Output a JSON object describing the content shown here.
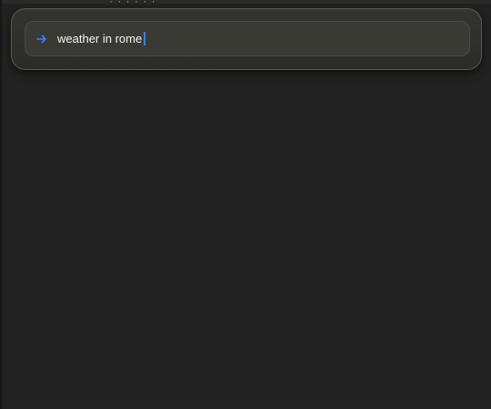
{
  "top_fragment": "· ·  ·   · ·  ·",
  "omnibox": {
    "query": "weather in rome",
    "icon": "arrow-right-icon",
    "accent_color": "#3b82f6"
  }
}
